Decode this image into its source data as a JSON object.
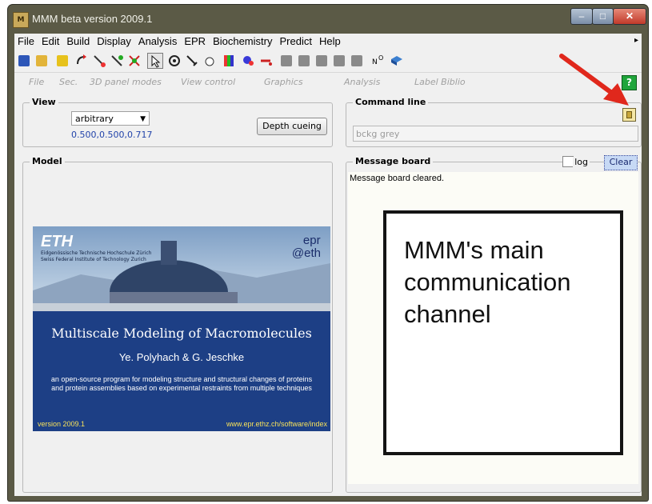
{
  "window": {
    "title": "MMM beta version 2009.1",
    "icon": "app-icon"
  },
  "menu": [
    "File",
    "Edit",
    "Build",
    "Display",
    "Analysis",
    "EPR",
    "Biochemistry",
    "Predict",
    "Help"
  ],
  "panel_modes": [
    "File",
    "Sec.",
    "3D panel modes",
    "View control",
    "Graphics",
    "Analysis",
    "Label Biblio"
  ],
  "help_label": "?",
  "view": {
    "title": "View",
    "select_value": "arbitrary",
    "coords": "0.500,0.500,0.717",
    "depth_button": "Depth cueing"
  },
  "command": {
    "title": "Command line",
    "value": "bckg grey"
  },
  "model": {
    "title": "Model"
  },
  "message": {
    "title": "Message board",
    "log_label": "log",
    "clear_label": "Clear",
    "text": "Message board cleared."
  },
  "callout": {
    "text": "MMM's main communication channel"
  },
  "splash": {
    "eth": "ETH",
    "eth_sub_1": "Eidgenössische Technische Hochschule Zürich",
    "eth_sub_2": "Swiss Federal Institute of Technology Zurich",
    "epr_1": "epr",
    "epr_2": "@eth",
    "title": "Multiscale Modeling of Macromolecules",
    "authors": "Ye. Polyhach & G. Jeschke",
    "desc": "an open-source program for modeling structure and structural changes of proteins and protein assemblies based on experimental restraints from multiple techniques",
    "version": "version 2009.1",
    "url": "www.epr.ethz.ch/software/index"
  },
  "colors": {
    "arrow": "#e0281c",
    "help": "#1fa53b",
    "splash_bg": "#1d3f85"
  }
}
